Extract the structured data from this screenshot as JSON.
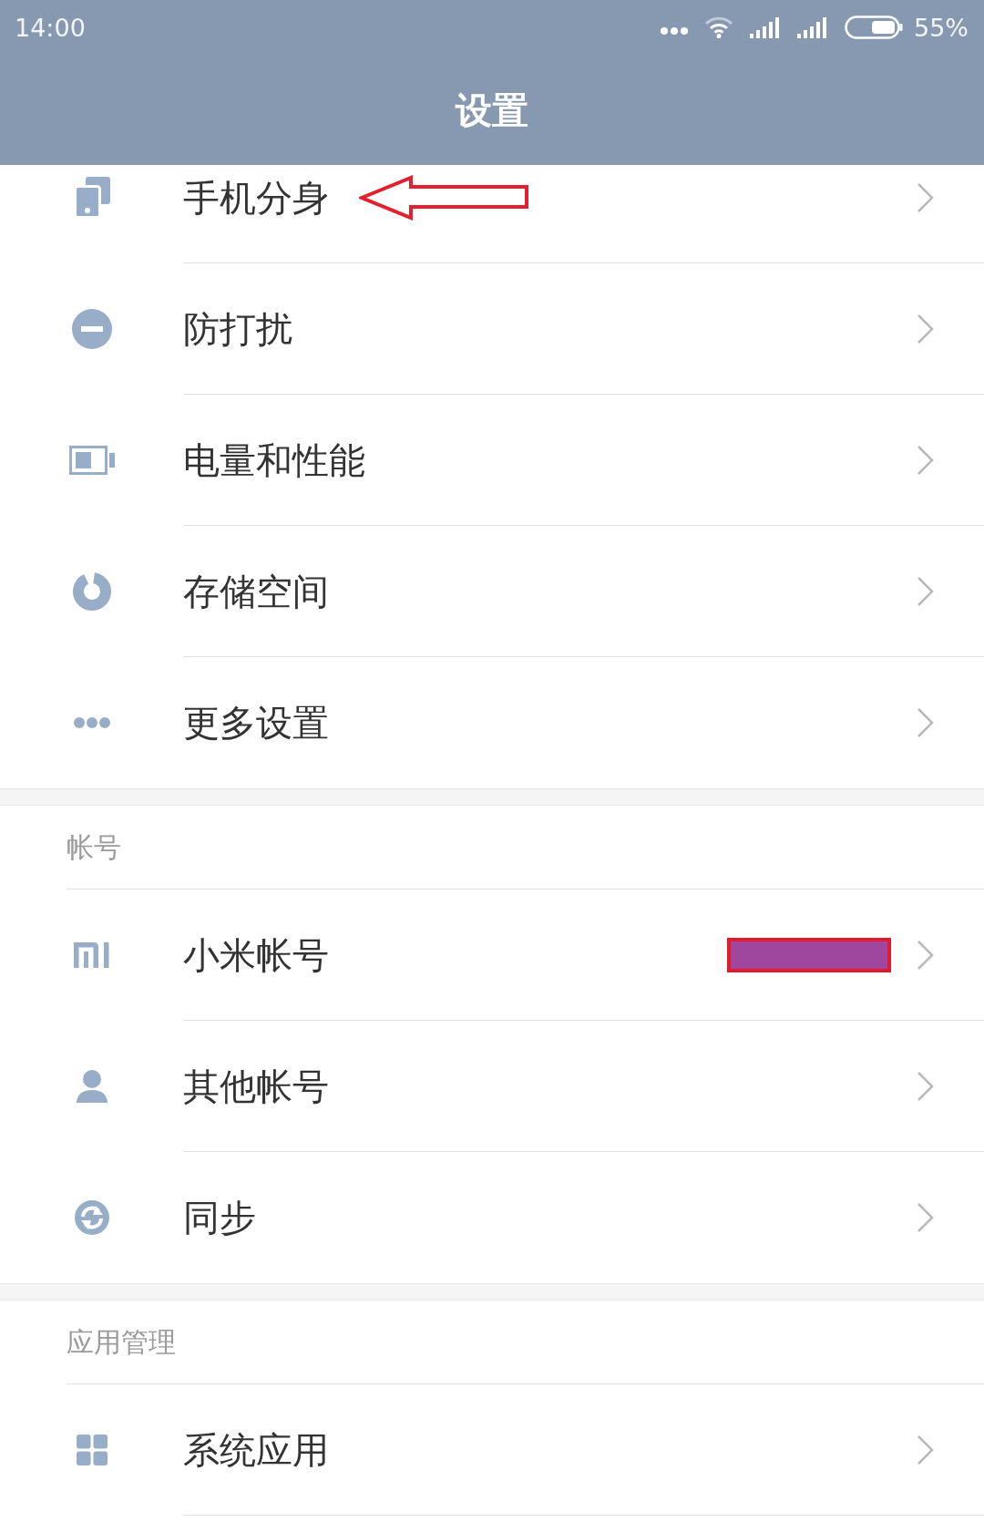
{
  "status_bar": {
    "time": "14:00",
    "battery_percent": "55%"
  },
  "header": {
    "title": "设置"
  },
  "sections": [
    {
      "rows": [
        {
          "label": "手机分身",
          "arrow_mark": true,
          "redacted": false
        },
        {
          "label": "防打扰",
          "arrow_mark": false,
          "redacted": false
        },
        {
          "label": "电量和性能",
          "arrow_mark": false,
          "redacted": false
        },
        {
          "label": "存储空间",
          "arrow_mark": false,
          "redacted": false
        },
        {
          "label": "更多设置",
          "arrow_mark": false,
          "redacted": false
        }
      ]
    },
    {
      "title": "帐号",
      "rows": [
        {
          "label": "小米帐号",
          "arrow_mark": false,
          "redacted": true
        },
        {
          "label": "其他帐号",
          "arrow_mark": false,
          "redacted": false
        },
        {
          "label": "同步",
          "arrow_mark": false,
          "redacted": false
        }
      ]
    },
    {
      "title": "应用管理",
      "rows": [
        {
          "label": "系统应用",
          "arrow_mark": false,
          "redacted": false
        }
      ]
    }
  ]
}
